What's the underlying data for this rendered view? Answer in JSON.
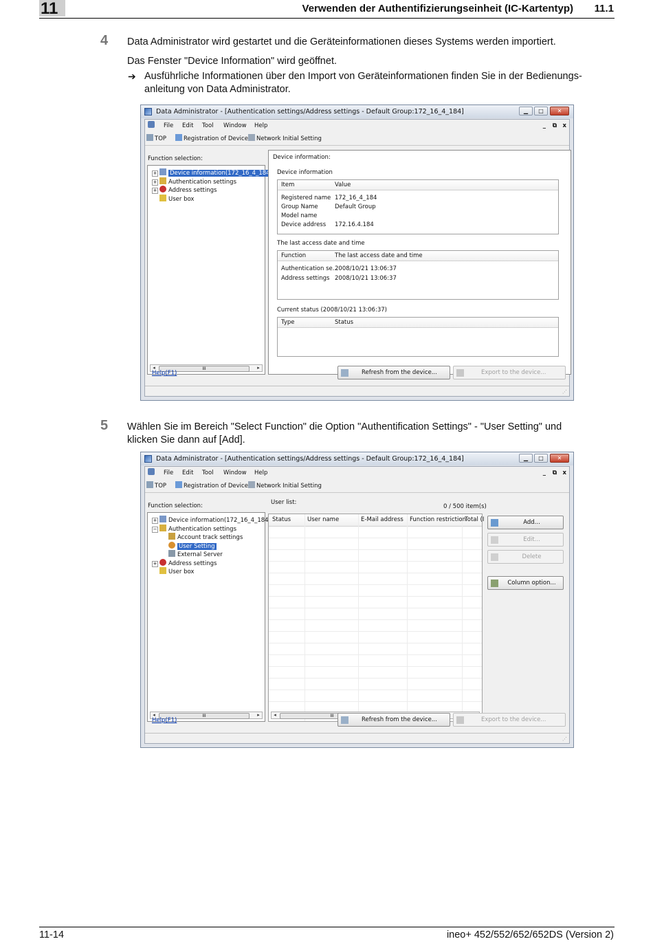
{
  "header": {
    "chapter": "11",
    "title": "Verwenden der Authentifizierungseinheit (IC-Kartentyp)",
    "section": "11.1"
  },
  "step4": {
    "number": "4",
    "line1": "Data Administrator wird gestartet und die Geräteinformationen dieses Systems werden importiert.",
    "line2": "Das Fenster \"Device Information\" wird geöffnet.",
    "arrow": "➔",
    "note_line1": "Ausführliche Informationen über den Import von Geräteinformationen finden Sie in der Bedienungs-",
    "note_line2": "anleitung von Data Administrator."
  },
  "step5": {
    "number": "5",
    "line1": "Wählen Sie im Bereich \"Select Function\" die Option \"Authentification Settings\" - \"User Setting\" und",
    "line2": "klicken Sie dann auf [Add]."
  },
  "window1": {
    "title": "Data Administrator - [Authentication settings/Address settings - Default Group:172_16_4_184]",
    "menu": [
      "File",
      "Edit",
      "Tool",
      "Window",
      "Help"
    ],
    "mdi_controls": [
      "_",
      "ð",
      "x"
    ],
    "toolbar": [
      "TOP",
      "Registration of Device",
      "Network Initial Setting"
    ],
    "function_selection_label": "Function selection:",
    "tree": [
      "Device information(172_16_4_184)",
      "Authentication settings",
      "Address settings",
      "User box"
    ],
    "scroll_mark": "III",
    "device_information_label": "Device information:",
    "group1_title": "Device information",
    "group1_headers": [
      "Item",
      "Value"
    ],
    "group1_rows": [
      [
        "Registered name",
        "172_16_4_184"
      ],
      [
        "Group Name",
        "Default Group"
      ],
      [
        "Model name",
        ""
      ],
      [
        "Device address",
        "172.16.4.184"
      ]
    ],
    "group2_title": "The last access date and time",
    "group2_headers": [
      "Function",
      "The last access date and time"
    ],
    "group2_rows": [
      [
        "Authentication se...",
        "2008/10/21 13:06:37"
      ],
      [
        "Address settings",
        "2008/10/21 13:06:37"
      ]
    ],
    "group3_title": "Current status (2008/10/21 13:06:37)",
    "group3_headers": [
      "Type",
      "Status"
    ],
    "help_link": "Help(F1)",
    "refresh_button": "Refresh from the device...",
    "export_button": "Export to the device..."
  },
  "window2": {
    "title": "Data Administrator - [Authentication settings/Address settings - Default Group:172_16_4_184]",
    "menu": [
      "File",
      "Edit",
      "Tool",
      "Window",
      "Help"
    ],
    "mdi_controls": [
      "_",
      "ð",
      "x"
    ],
    "toolbar": [
      "TOP",
      "Registration of Device",
      "Network Initial Setting"
    ],
    "function_selection_label": "Function selection:",
    "tree": [
      "Device information(172_16_4_184)",
      "Authentication settings",
      "Account track settings",
      "User Setting",
      "External Server",
      "Address settings",
      "User box"
    ],
    "scroll_mark": "III",
    "user_list_label": "User list:",
    "item_count": "0 / 500 item(s)",
    "columns": [
      "Status",
      "User name",
      "E-Mail address",
      "Function restriction",
      "Total (I"
    ],
    "add_button": "Add...",
    "edit_button": "Edit...",
    "delete_button": "Delete",
    "column_option_button": "Column option...",
    "help_link": "Help(F1)",
    "refresh_button": "Refresh from the device...",
    "export_button": "Export to the device..."
  },
  "footer": {
    "page": "11-14",
    "product": "ineo+ 452/552/652/652DS (Version 2)"
  }
}
